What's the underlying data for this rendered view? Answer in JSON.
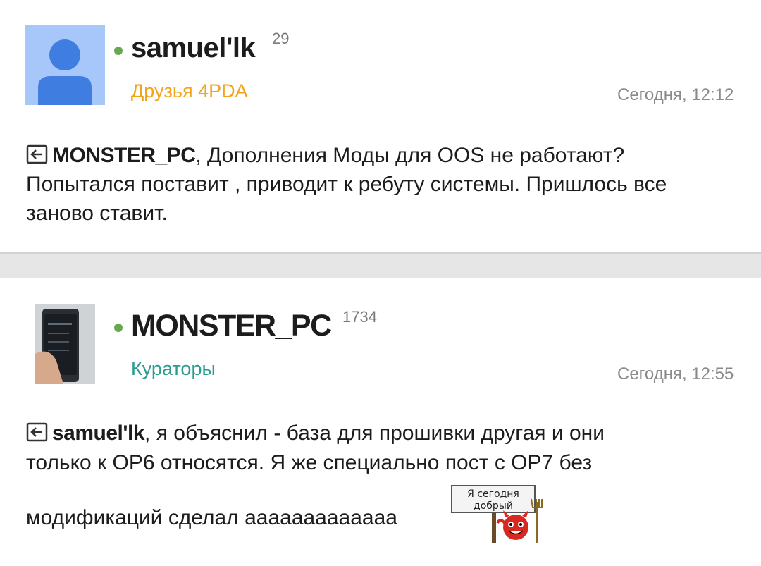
{
  "posts": [
    {
      "author": "samuel'lk",
      "reputation": "29",
      "group": "Друзья 4PDA",
      "timestamp": "Сегодня, 12:12",
      "quote_author": "MONSTER_PC",
      "text": ", Дополнения Моды для OOS не работают? Попытался поставит , приводит к ребуту системы. Пришлось все заново ставит.",
      "colors": {
        "group": "#f2a31c",
        "avatar_bg": "#a7c7fa"
      }
    },
    {
      "author": "MONSTER_PC",
      "reputation": "1734",
      "group": "Кураторы",
      "timestamp": "Сегодня, 12:55",
      "quote_author": "samuel'lk",
      "text_line1": ", я объяснил - база для прошивки другая и они",
      "text_line2": "только к OP6 относятся. Я же специально пост с OP7 без",
      "text_line3": "модификаций сделал ааааааааааааа",
      "smiley_sign": "Я сегодня добрый",
      "colors": {
        "group": "#2a9d8f"
      }
    }
  ],
  "icons": {
    "online": "online-dot-icon",
    "quote": "reply-quote-icon",
    "smiley": "devil-smiley-icon"
  }
}
